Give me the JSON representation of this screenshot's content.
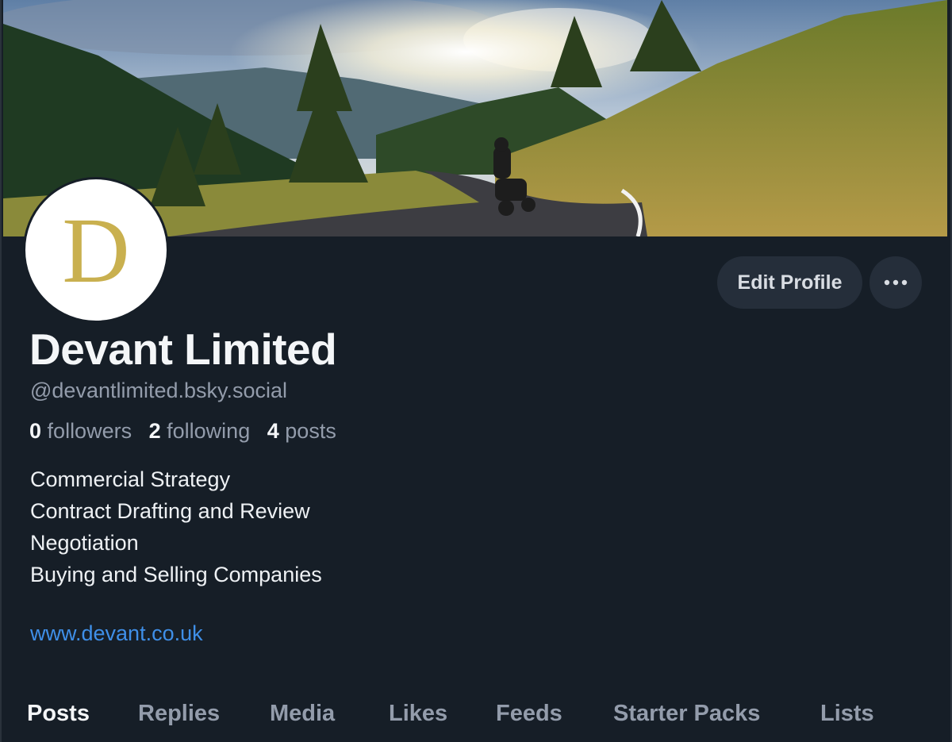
{
  "profile": {
    "avatar_letter": "D",
    "display_name": "Devant Limited",
    "handle": "@devantlimited.bsky.social",
    "stats": {
      "followers_count": "0",
      "followers_label": "followers",
      "following_count": "2",
      "following_label": "following",
      "posts_count": "4",
      "posts_label": "posts"
    },
    "bio_lines": [
      "Commercial Strategy",
      "Contract Drafting and Review",
      "Negotiation",
      "Buying and Selling Companies"
    ],
    "website": "www.devant.co.uk"
  },
  "actions": {
    "edit_label": "Edit Profile",
    "more_icon": "more-horizontal-icon"
  },
  "tabs": [
    {
      "label": "Posts",
      "active": true
    },
    {
      "label": "Replies",
      "active": false
    },
    {
      "label": "Media",
      "active": false
    },
    {
      "label": "Likes",
      "active": false
    },
    {
      "label": "Feeds",
      "active": false
    },
    {
      "label": "Starter Packs",
      "active": false
    },
    {
      "label": "Lists",
      "active": false
    }
  ],
  "colors": {
    "background": "#161e27",
    "button": "#252e3a",
    "muted_text": "#939cab",
    "link": "#3f8fe8",
    "avatar_letter": "#c9b04f"
  }
}
